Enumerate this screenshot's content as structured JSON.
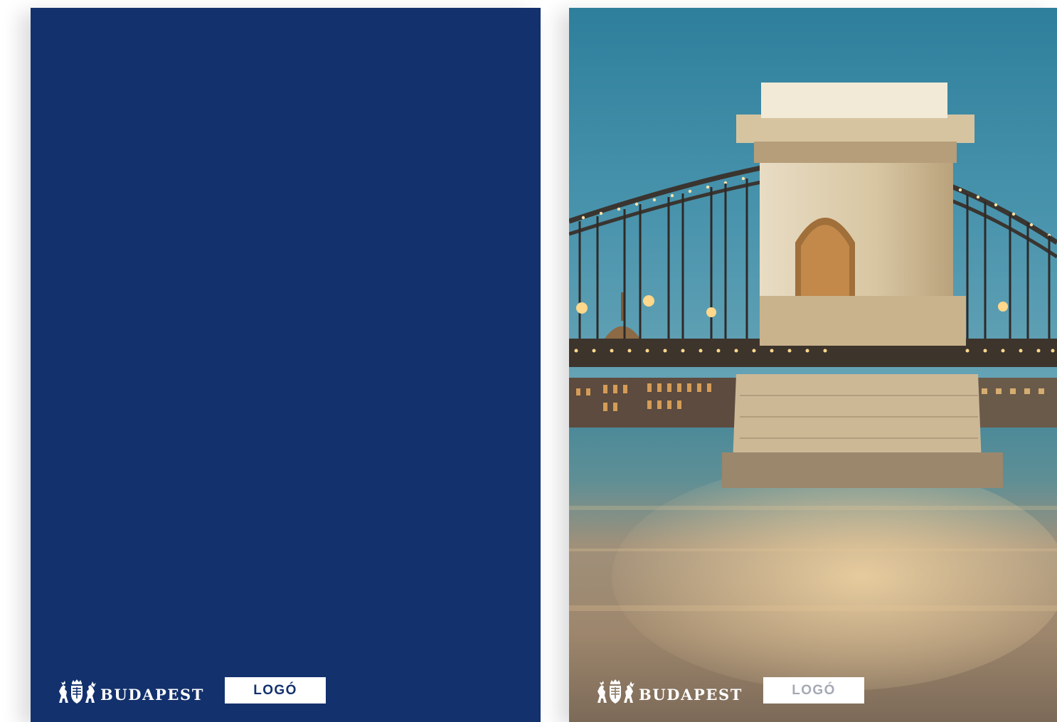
{
  "colors": {
    "brand_blue": "#13316c",
    "logo_text_blue": "#13316c",
    "logo_text_grey": "#a4a9b4",
    "white": "#ffffff"
  },
  "cards": [
    {
      "background": "solid-blue",
      "brand_label": "BUDAPEST",
      "logo_label": "LOGÓ",
      "crest_icon": "budapest-coat-of-arms-icon"
    },
    {
      "background": "chain-bridge-night-photo",
      "brand_label": "BUDAPEST",
      "logo_label": "LOGÓ",
      "crest_icon": "budapest-coat-of-arms-icon"
    }
  ]
}
